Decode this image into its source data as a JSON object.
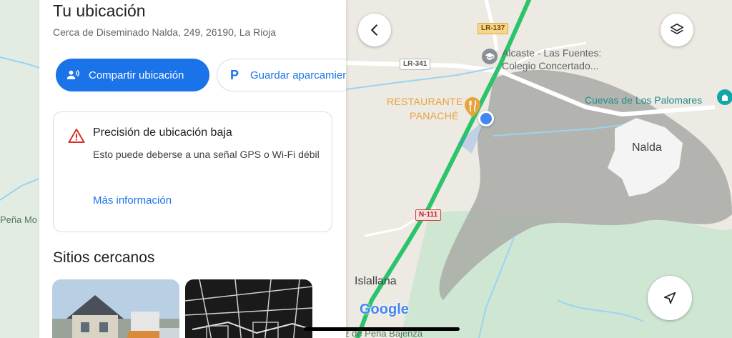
{
  "panel": {
    "title": "Tu ubicación",
    "address": "Cerca de Diseminado Nalda, 249, 26190, La Rioja",
    "share_button": "Compartir ubicación",
    "park_button": "Guardar aparcamiento",
    "warning": {
      "title": "Precisión de ubicación baja",
      "body": "Esto puede deberse a una señal GPS o Wi-Fi débil",
      "link": "Más información"
    },
    "nearby_title": "Sitios cercanos"
  },
  "map": {
    "labels": {
      "school": "Alcaste - Las Fuentes: Colegio Concertado...",
      "restaurant_line1": "RESTAURANTE",
      "restaurant_line2": "PANACHÉ",
      "caves": "Cuevas de Los Palomares",
      "nalda": "Nalda",
      "islallana": "Islallana",
      "pena": "Peña Mo",
      "bottom_place": "z de Peña Bajenza"
    },
    "road_badges": {
      "lr137": "LR-137",
      "lr341": "LR-341",
      "n111": "N-111"
    },
    "attribution": "Google"
  },
  "icons": {
    "back": "chevron-left-icon",
    "layers": "layers-icon",
    "locate": "navigation-arrow-icon",
    "share": "person-share-icon",
    "parking": "parking-p-icon",
    "warning": "warning-triangle-icon"
  },
  "colors": {
    "accent": "#1a73e8",
    "warning": "#d93025",
    "route": "#2bc46b",
    "restaurant": "#e8a33d",
    "location_dot": "#4285f4"
  }
}
